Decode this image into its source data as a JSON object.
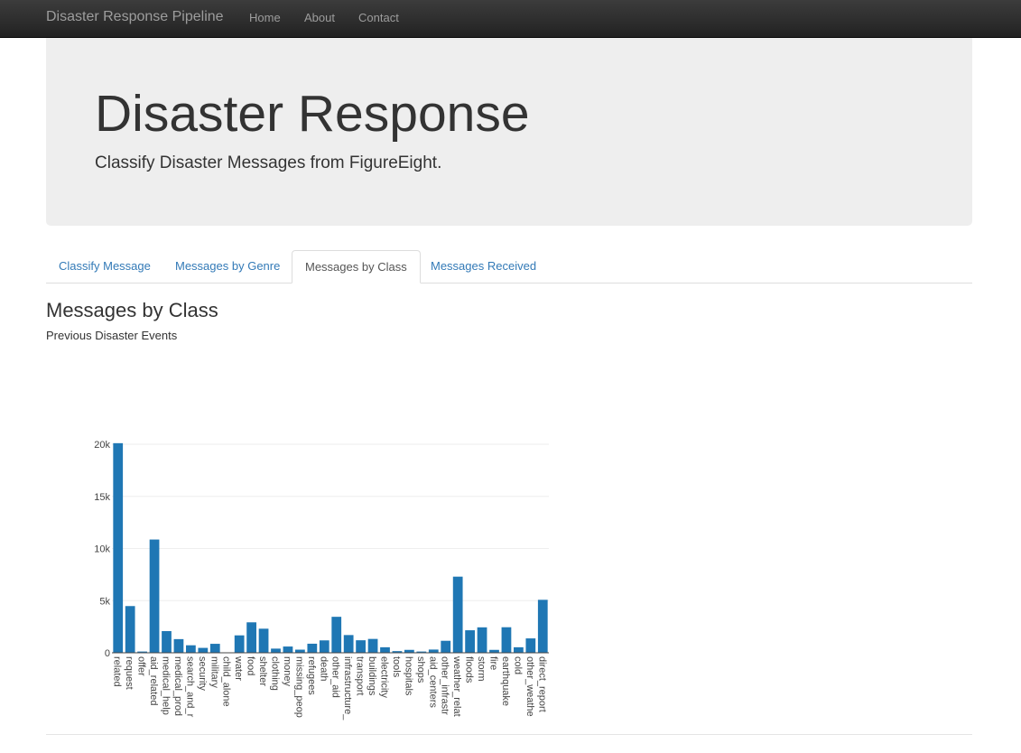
{
  "navbar": {
    "brand": "Disaster Response Pipeline",
    "links": [
      "Home",
      "About",
      "Contact"
    ]
  },
  "jumbotron": {
    "title": "Disaster Response",
    "subtitle": "Classify Disaster Messages from FigureEight."
  },
  "tabs": [
    {
      "label": "Classify Message",
      "active": false
    },
    {
      "label": "Messages by Genre",
      "active": false
    },
    {
      "label": "Messages by Class",
      "active": true
    },
    {
      "label": "Messages Received",
      "active": false
    }
  ],
  "section": {
    "title": "Messages by Class",
    "subtitle": "Previous Disaster Events"
  },
  "colors": {
    "bar": "#1f77b4",
    "navbar": "#222222",
    "link": "#337ab7"
  },
  "chart_data": {
    "type": "bar",
    "title": "",
    "xlabel": "",
    "ylabel": "",
    "ylim": [
      0,
      20000
    ],
    "yticks": [
      0,
      5000,
      10000,
      15000,
      20000
    ],
    "ytick_labels": [
      "0",
      "5k",
      "10k",
      "15k",
      "20k"
    ],
    "grid": true,
    "categories": [
      "related",
      "request",
      "offer",
      "aid_related",
      "medical_help",
      "medical_products",
      "search_and_rescue",
      "security",
      "military",
      "child_alone",
      "water",
      "food",
      "shelter",
      "clothing",
      "money",
      "missing_people",
      "refugees",
      "death",
      "other_aid",
      "infrastructure_related",
      "transport",
      "buildings",
      "electricity",
      "tools",
      "hospitals",
      "shops",
      "aid_centers",
      "other_infrastructure",
      "weather_related",
      "floods",
      "storm",
      "fire",
      "earthquake",
      "cold",
      "other_weather",
      "direct_report"
    ],
    "category_labels": [
      "related",
      "request",
      "offer",
      "aid_related",
      "medical_help",
      "medical_prod",
      "search_and_r",
      "security",
      "military",
      "child_alone",
      "water",
      "food",
      "shelter",
      "clothing",
      "money",
      "missing_peop",
      "refugees",
      "death",
      "other_aid",
      "infrastructure_",
      "transport",
      "buildings",
      "electricity",
      "tools",
      "hospitals",
      "shops",
      "aid_centers",
      "other_infrastr",
      "weather_relat",
      "floods",
      "storm",
      "fire",
      "earthquake",
      "cold",
      "other_weathe",
      "direct_report"
    ],
    "values": [
      20100,
      4480,
      120,
      10860,
      2080,
      1310,
      720,
      470,
      860,
      0,
      1670,
      2920,
      2310,
      400,
      600,
      300,
      870,
      1190,
      3450,
      1700,
      1200,
      1330,
      530,
      160,
      280,
      120,
      310,
      1150,
      7300,
      2160,
      2440,
      280,
      2450,
      530,
      1380,
      5080
    ]
  }
}
